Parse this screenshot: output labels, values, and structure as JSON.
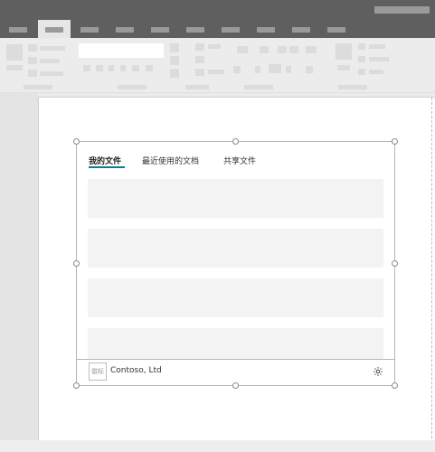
{
  "webpart": {
    "tabs": [
      {
        "label": "我的文件",
        "active": true
      },
      {
        "label": "最近使用的文档",
        "active": false
      },
      {
        "label": "共享文件",
        "active": false
      }
    ],
    "document_rows": 4,
    "footer": {
      "logo_text": "徽标",
      "company": "Contoso, Ltd",
      "settings_icon": "gear-icon"
    },
    "accent_color": "#117a8b"
  }
}
